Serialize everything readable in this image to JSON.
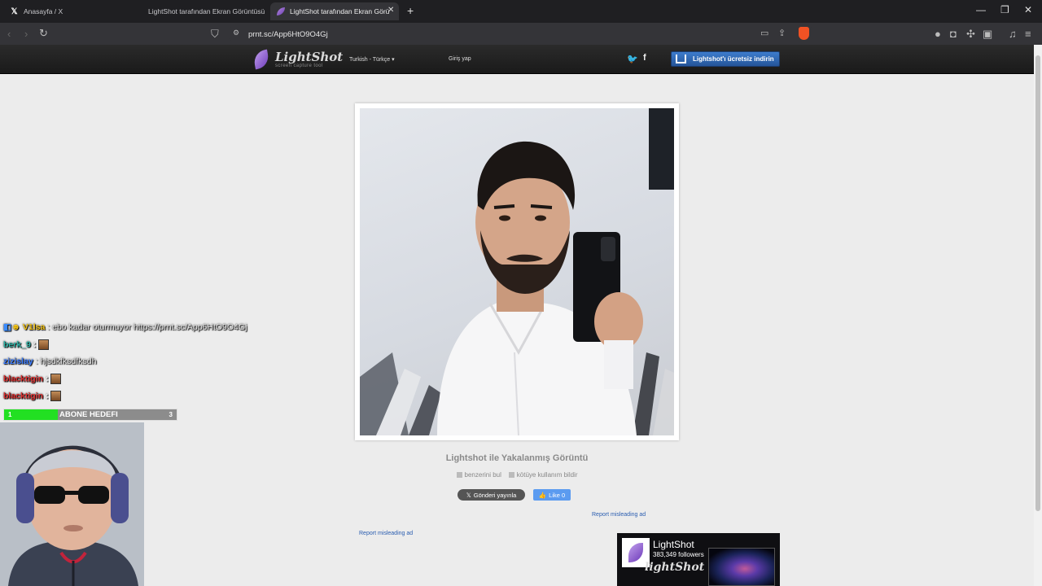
{
  "browser": {
    "tabs": [
      {
        "label": "Anasayfa / X",
        "favicon": "x-icon"
      },
      {
        "label": "LightShot tarafından Ekran Görüntüsü",
        "favicon": "lightshot-icon"
      },
      {
        "label": "LightShot tarafından Ekran Görü",
        "favicon": "lightshot-icon"
      }
    ],
    "url": "prnt.sc/App6HtO9O4Gj"
  },
  "lightshot": {
    "logo": "LightShot",
    "tagline": "screen capture tool",
    "language": "Turkish - Türkçe",
    "login": "Giriş yap",
    "download": "Lightshot'ı ücretsiz indirin",
    "caption": "Lightshot ile Yakalanmış Görüntü",
    "find_similar": "benzerini bul",
    "report_abuse": "kötüye kullanım bildir",
    "tweet": "Gönderi yayınla",
    "like": "Like 0",
    "report_ad_1": "Report misleading ad",
    "report_ad_2": "Report misleading ad",
    "fb_page_name": "LightShot",
    "fb_followers": "383,349 followers",
    "fb_brand": "lightShot"
  },
  "chat": [
    {
      "user": "V1lsa",
      "message": ": ebo kadar oturmuyor https://prnt.sc/App6HtO9O4Gj",
      "color": "#f5c518"
    },
    {
      "user": "berk_9",
      "message": ":",
      "color": "#2fb5a8",
      "emote": true
    },
    {
      "user": "zizislay",
      "message": ": hjsdkfksdfksdh",
      "color": "#3b7cff"
    },
    {
      "user": "blacktigin",
      "message": ":",
      "color": "#e03131",
      "emote": true
    },
    {
      "user": "blacktigin",
      "message": ":",
      "color": "#e03131",
      "emote": true
    }
  ],
  "goal": {
    "label": "ABONE HEDEFI",
    "current": "1",
    "target": "3",
    "progress": 0.31
  }
}
